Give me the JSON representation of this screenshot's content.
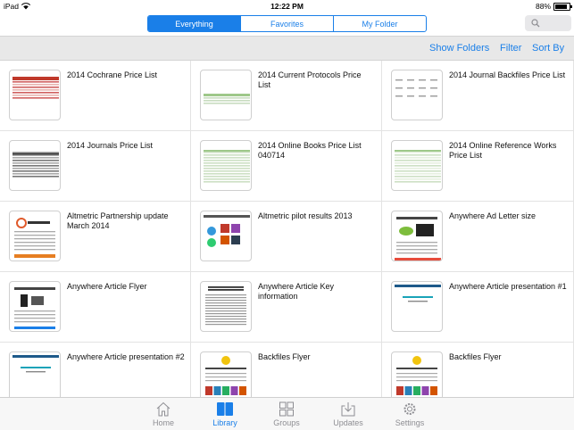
{
  "status": {
    "device": "iPad",
    "time": "12:22 PM",
    "battery": "88%",
    "battery_level": 0.88
  },
  "segments": [
    "Everything",
    "Favorites",
    "My Folder"
  ],
  "toolbar": {
    "show_folders": "Show Folders",
    "filter": "Filter",
    "sort_by": "Sort By"
  },
  "items": [
    {
      "title": "2014 Cochrane Price List",
      "thumb": "red-table"
    },
    {
      "title": "2014 Current Protocols Price List",
      "thumb": "green-table"
    },
    {
      "title": "2014 Journal Backfiles Price List",
      "thumb": "sparse-table"
    },
    {
      "title": "2014 Journals Price List",
      "thumb": "dense-table"
    },
    {
      "title": "2014 Online Books Price List 040714",
      "thumb": "green-table-b"
    },
    {
      "title": "2014 Online Reference Works Price List",
      "thumb": "green-table-c"
    },
    {
      "title": "Altmetric Partnership update March 2014",
      "thumb": "altmetric-doc"
    },
    {
      "title": "Altmetric pilot results 2013",
      "thumb": "altmetric-slide"
    },
    {
      "title": "Anywhere Ad Letter size",
      "thumb": "anywhere-ad"
    },
    {
      "title": "Anywhere Article Flyer",
      "thumb": "anywhere-flyer"
    },
    {
      "title": "Anywhere Article Key information",
      "thumb": "text-doc"
    },
    {
      "title": "Anywhere Article presentation #1",
      "thumb": "presentation"
    },
    {
      "title": "Anywhere Article presentation #2",
      "thumb": "presentation"
    },
    {
      "title": "Backfiles Flyer",
      "thumb": "backfiles"
    },
    {
      "title": "Backfiles Flyer",
      "thumb": "backfiles"
    }
  ],
  "tabs": [
    {
      "label": "Home",
      "icon": "home-icon"
    },
    {
      "label": "Library",
      "icon": "library-icon"
    },
    {
      "label": "Groups",
      "icon": "groups-icon"
    },
    {
      "label": "Updates",
      "icon": "updates-icon"
    },
    {
      "label": "Settings",
      "icon": "settings-icon"
    }
  ],
  "colors": {
    "accent": "#1a7fe8",
    "toolbar_bg": "#e8e8e8",
    "tab_inactive": "#8e8e93"
  }
}
